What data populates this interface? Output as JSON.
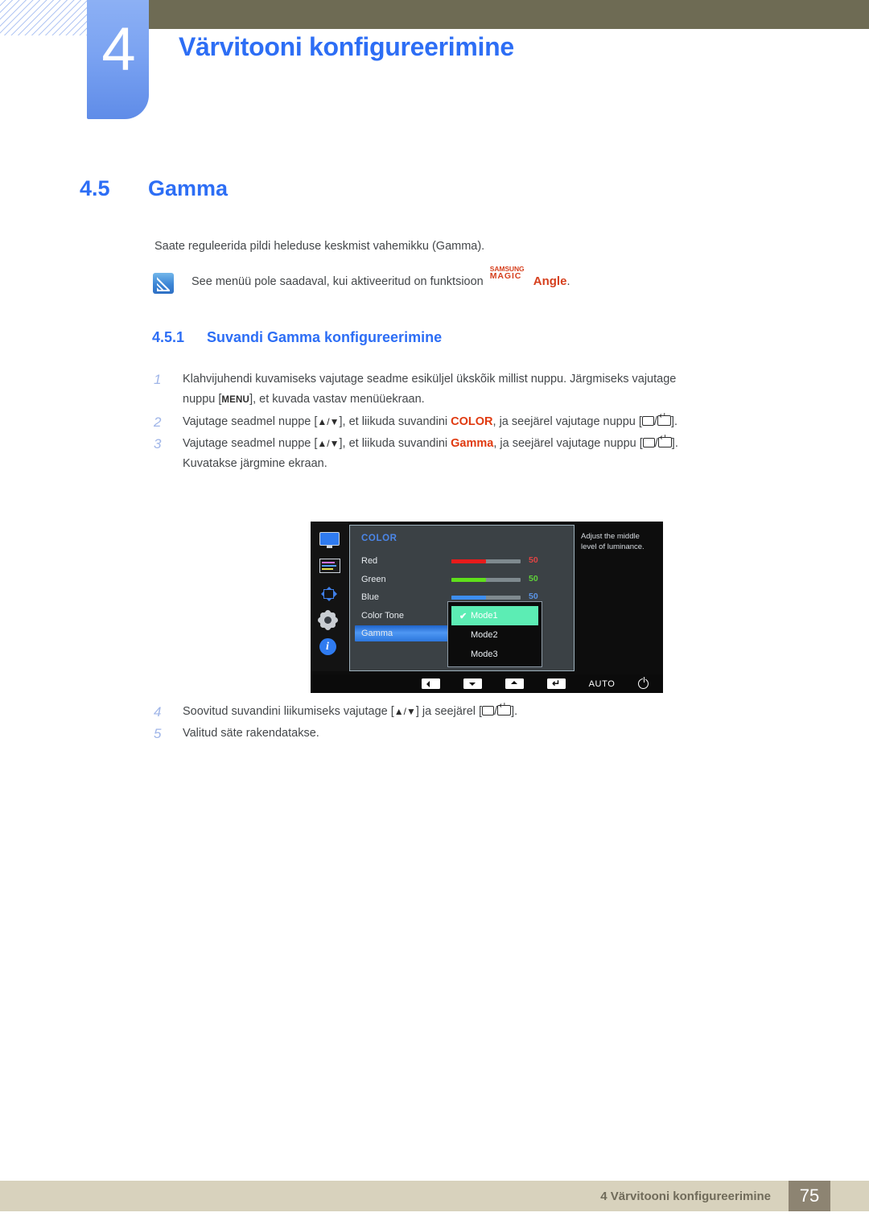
{
  "chapter": {
    "number": "4",
    "title": "Värvitooni konfigureerimine"
  },
  "section": {
    "number": "4.5",
    "title": "Gamma"
  },
  "intro": "Saate reguleerida pildi heleduse keskmist vahemikku (Gamma).",
  "note": {
    "icon": "note-pencil-icon",
    "text_before": "See menüü pole saadaval, kui aktiveeritud on funktsioon",
    "magic_top": "SAMSUNG",
    "magic_bottom": "MAGIC",
    "magic_suffix": "Angle",
    "text_after": "."
  },
  "subsection": {
    "number": "4.5.1",
    "title": "Suvandi Gamma konfigureerimine"
  },
  "steps": [
    {
      "num": "1",
      "line1_a": "Klahvijuhendi kuvamiseks vajutage seadme esiküljel ükskõik millist nuppu. Järgmiseks vajutage",
      "line2_a": "nuppu [",
      "key": "MENU",
      "line2_b": "], et kuvada vastav menüüekraan."
    },
    {
      "num": "2",
      "a": "Vajutage seadmel nuppe [",
      "arrows": "▲/▼",
      "b": "], et liikuda suvandini",
      "kw": "COLOR",
      "c": ", ja seejärel vajutage nuppu [",
      "d": "]."
    },
    {
      "num": "3",
      "a": "Vajutage seadmel nuppe [",
      "arrows": "▲/▼",
      "b": "], et liikuda suvandini",
      "kw": "Gamma",
      "c": ", ja seejärel vajutage nuppu [",
      "d": "].",
      "line2": "Kuvatakse järgmine ekraan."
    },
    {
      "num": "4",
      "a": "Soovitud suvandini liikumiseks vajutage [",
      "arrows": "▲/▼",
      "b": "] ja seejärel [",
      "d": "]."
    },
    {
      "num": "5",
      "a": "Valitud säte rakendatakse."
    }
  ],
  "osd": {
    "sidebar_icons": [
      "monitor-icon",
      "color-bars-icon",
      "position-arrows-icon",
      "gear-icon",
      "info-icon"
    ],
    "heading": "COLOR",
    "rows": [
      {
        "label": "Red",
        "value": "50",
        "color": "#e81b1b",
        "value_color": "#e04444",
        "slider": 50
      },
      {
        "label": "Green",
        "value": "50",
        "color": "#5fe01b",
        "value_color": "#5fd13a",
        "slider": 50
      },
      {
        "label": "Blue",
        "value": "50",
        "color": "#3d8ef0",
        "value_color": "#5b95e6",
        "slider": 50
      },
      {
        "label": "Color Tone",
        "value": "",
        "color": "",
        "value_color": "",
        "slider": null
      },
      {
        "label": "Gamma",
        "value": "",
        "color": "",
        "value_color": "",
        "slider": null,
        "highlighted": true
      }
    ],
    "dropdown": {
      "items": [
        {
          "label": "Mode1",
          "selected": true
        },
        {
          "label": "Mode2",
          "selected": false
        },
        {
          "label": "Mode3",
          "selected": false
        }
      ],
      "check_glyph": "✔",
      "selected_color": "#5cedb4"
    },
    "tip": "Adjust the middle level of luminance.",
    "buttons": [
      {
        "name": "left-arrow-button",
        "glyph": "◀"
      },
      {
        "name": "down-arrow-button",
        "glyph": "▼"
      },
      {
        "name": "up-arrow-button",
        "glyph": "▲"
      },
      {
        "name": "enter-button",
        "glyph": "↵"
      },
      {
        "name": "auto-button",
        "glyph": "AUTO"
      },
      {
        "name": "power-button",
        "glyph": "⏻"
      }
    ],
    "auto_label": "AUTO"
  },
  "footer": {
    "text": "4 Värvitooni konfigureerimine",
    "page": "75"
  },
  "colors": {
    "accent_blue": "#2d6ef5",
    "accent_red": "#e03a10",
    "olive": "#6e6b54",
    "footer_bar": "#d8d2bd",
    "footer_page": "#8d8472"
  }
}
